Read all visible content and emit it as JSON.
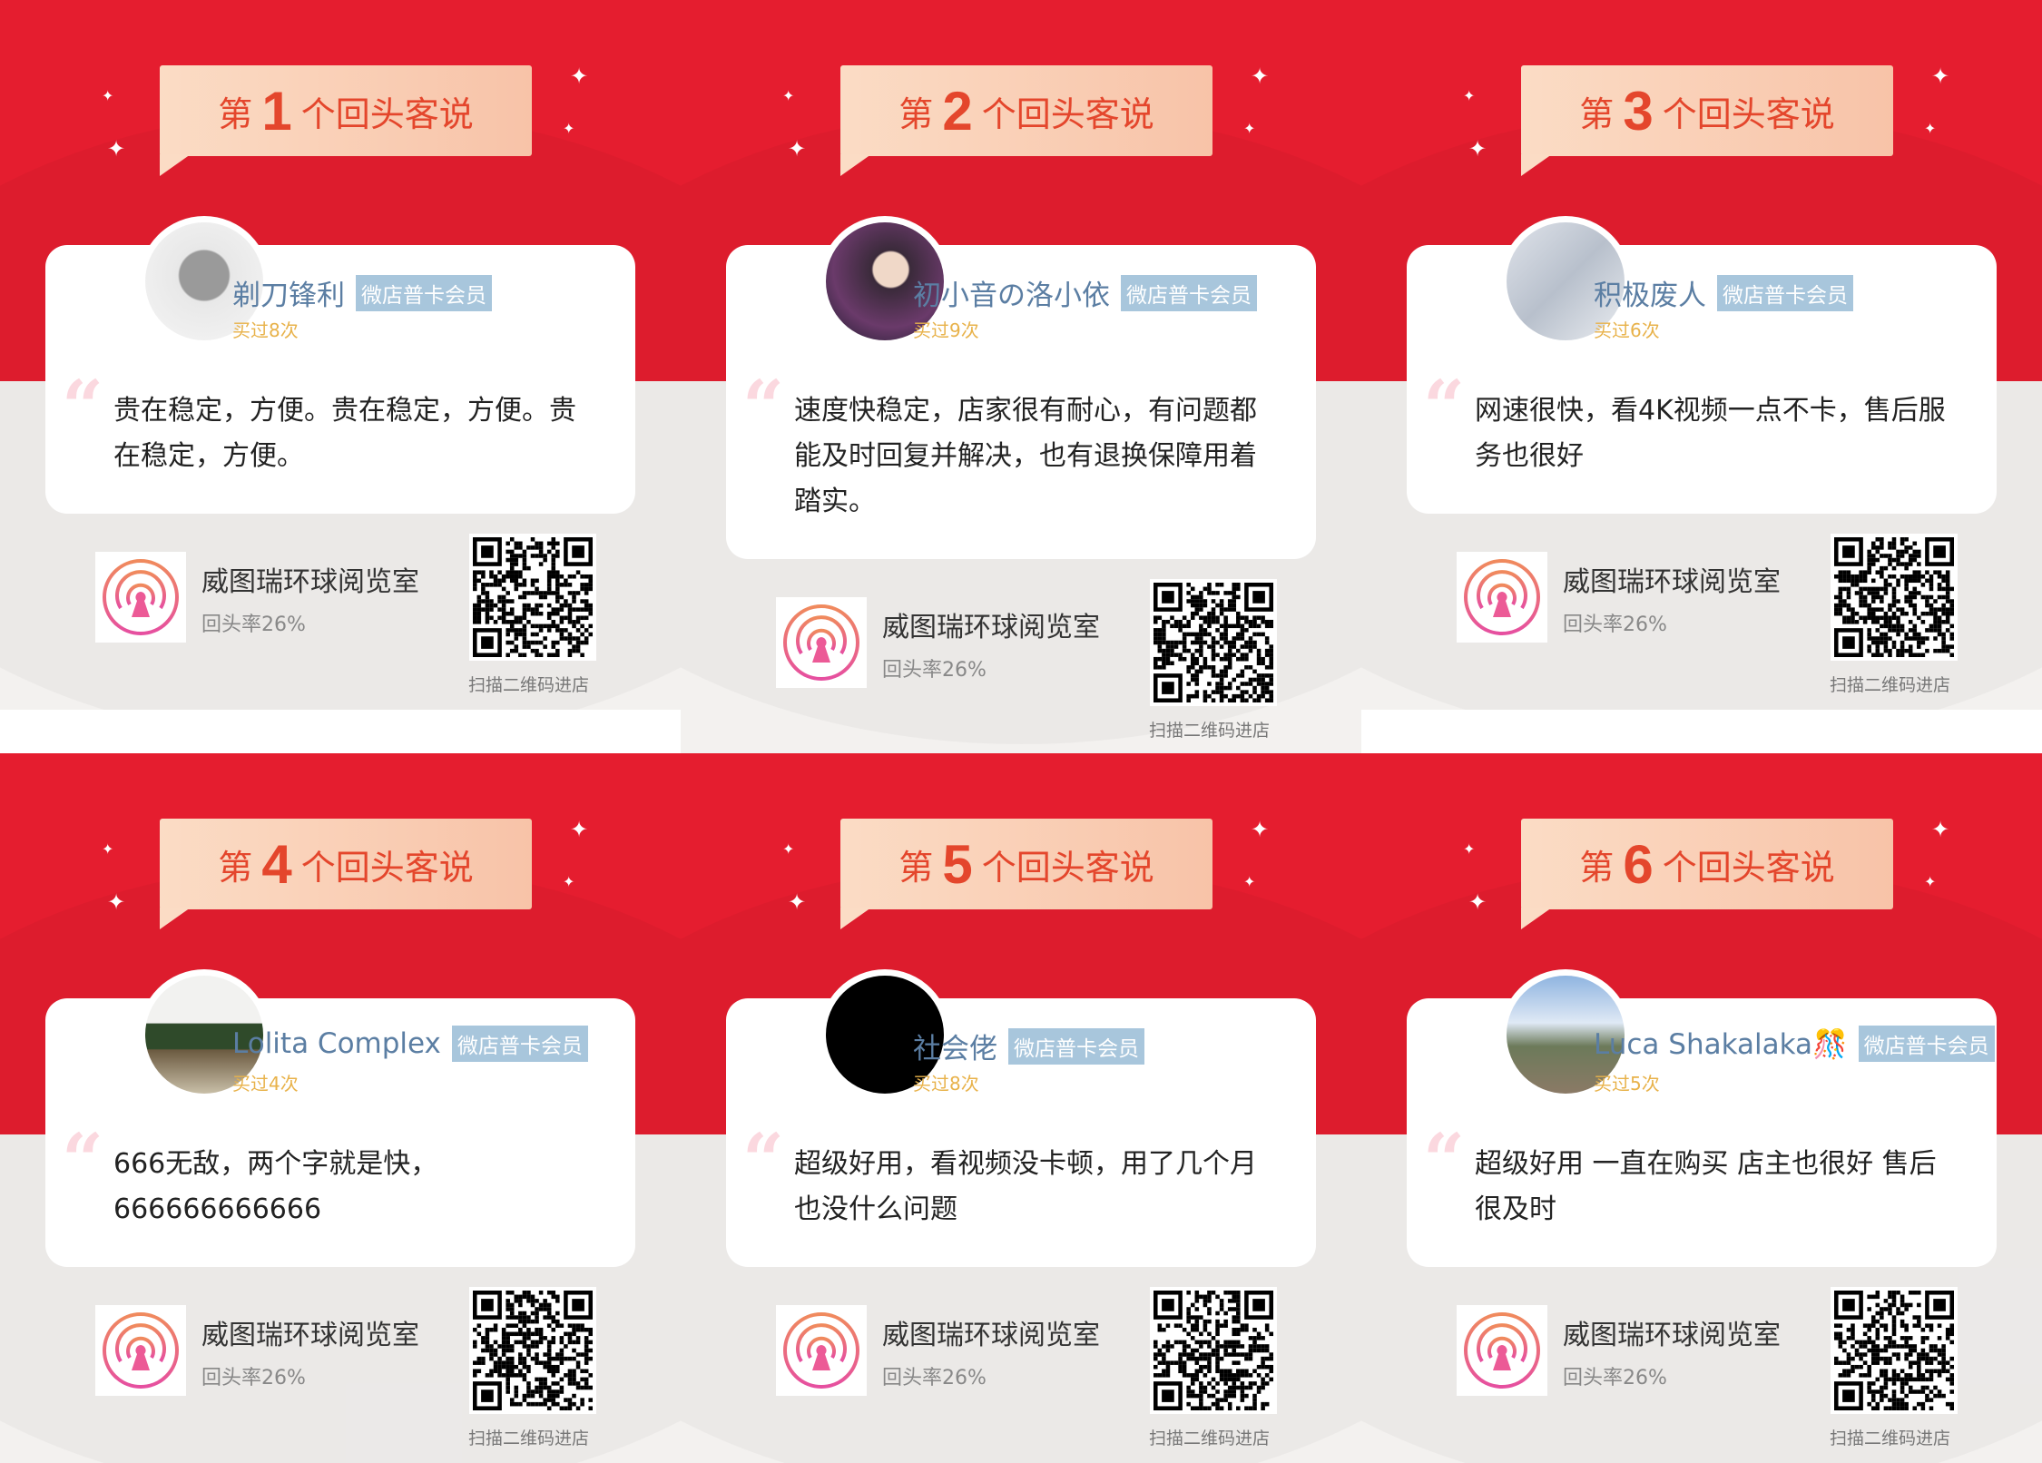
{
  "colors": {
    "red": "#e51d2f",
    "banner_text": "#e4462c",
    "name": "#5b7ea3",
    "badge": "#a8c6dc",
    "times": "#e8b24a"
  },
  "common": {
    "banner_prefix": "第",
    "banner_suffix": "个回头客说",
    "badge": "微店普卡会员",
    "store_name": "威图瑞环球阅览室",
    "return_rate": "回头率26%",
    "scan_label": "扫描二维码进店",
    "quote_icon": "quote-icon",
    "logo_icon": "broadcast-logo-icon"
  },
  "reviews": [
    {
      "rank": "1",
      "name": "剃刀锋利",
      "times": "买过8次",
      "text": "贵在稳定，方便。贵在稳定，方便。贵在稳定，方便。"
    },
    {
      "rank": "2",
      "name": "初小音の洛小依",
      "times": "买过9次",
      "text": "速度快稳定，店家很有耐心，有问题都能及时回复并解决，也有退换保障用着踏实。"
    },
    {
      "rank": "3",
      "name": "积极废人",
      "times": "买过6次",
      "text": "网速很快，看4K视频一点不卡，售后服务也很好"
    },
    {
      "rank": "4",
      "name": "Lolita Complex",
      "times": "买过4次",
      "text": "666无敌，两个字就是快，666666666666"
    },
    {
      "rank": "5",
      "name": "社会佬",
      "times": "买过8次",
      "text": "超级好用，看视频没卡顿，用了几个月也没什么问题"
    },
    {
      "rank": "6",
      "name": "Luca Shakalaka🎊",
      "times": "买过5次",
      "text": "超级好用 一直在购买 店主也很好 售后很及时"
    }
  ]
}
